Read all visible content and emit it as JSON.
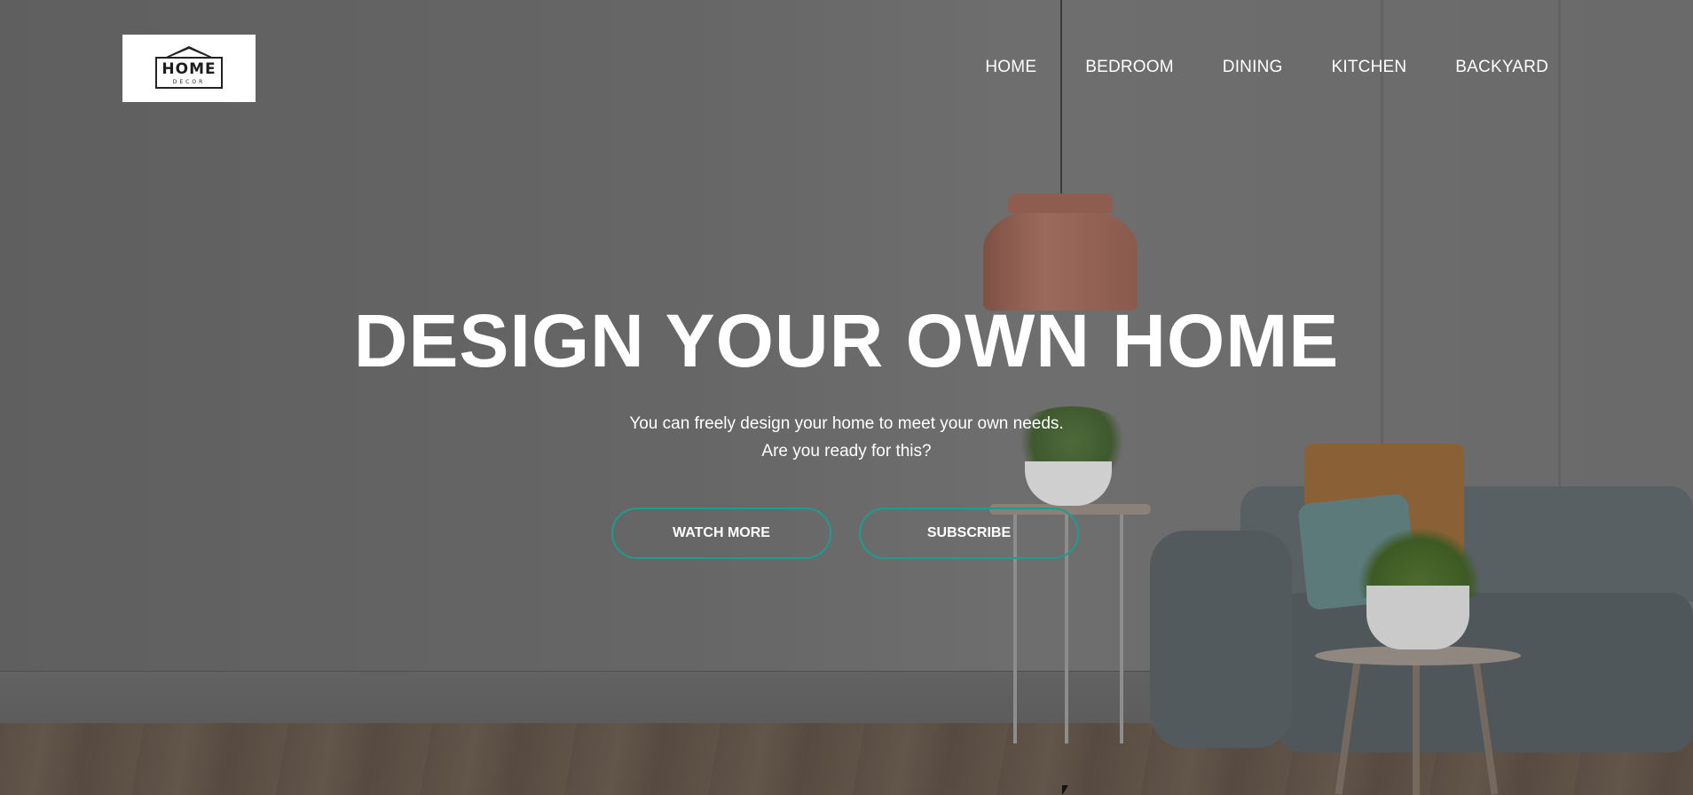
{
  "brand": {
    "logo_word": "HOME",
    "logo_sub": "DECOR"
  },
  "nav": {
    "items": [
      {
        "label": "HOME"
      },
      {
        "label": "BEDROOM"
      },
      {
        "label": "DINING"
      },
      {
        "label": "KITCHEN"
      },
      {
        "label": "BACKYARD"
      }
    ]
  },
  "hero": {
    "title": "DESIGN YOUR OWN HOME",
    "subtitle_line1": "You can freely design your home to meet your own needs.",
    "subtitle_line2": "Are you ready for this?",
    "watch_label": "WATCH MORE",
    "subscribe_label": "SUBSCRIBE"
  },
  "colors": {
    "accent": "#1a9e8f",
    "text": "#ffffff",
    "overlay": "#666666"
  }
}
